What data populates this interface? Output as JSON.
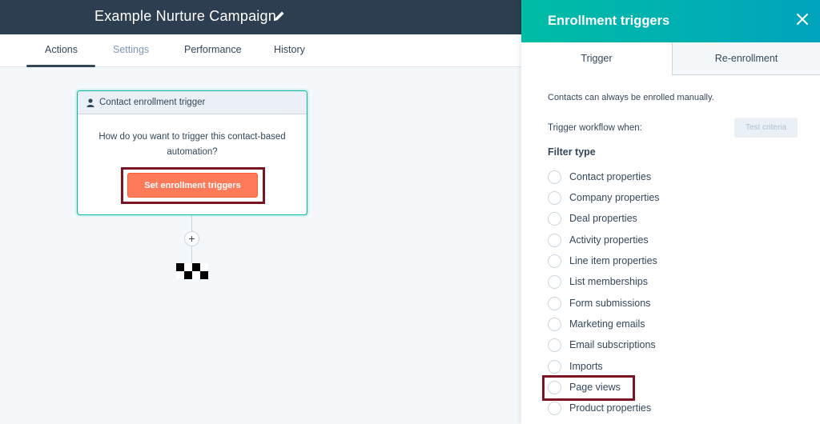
{
  "header": {
    "title": "Example Nurture Campaign",
    "edit_icon": "pencil-icon"
  },
  "tabs": [
    {
      "label": "Actions",
      "active": true
    },
    {
      "label": "Settings",
      "active": false
    },
    {
      "label": "Performance",
      "active": false
    },
    {
      "label": "History",
      "active": false
    }
  ],
  "card": {
    "header_icon": "person-icon",
    "header_label": "Contact enrollment trigger",
    "question_line1": "How do you want to trigger this contact-based",
    "question_line2": "automation?",
    "button_label": "Set enrollment triggers",
    "button_color": "#ff7a59"
  },
  "connector": {
    "plus_label": "+",
    "end_icon": "checkered-flag-icon"
  },
  "panel": {
    "title": "Enrollment triggers",
    "close_icon": "close-icon",
    "tabs": [
      {
        "label": "Trigger",
        "active": true
      },
      {
        "label": "Re-enrollment",
        "active": false
      }
    ],
    "note": "Contacts can always be enrolled manually.",
    "trigger_when": "Trigger workflow when:",
    "test_button": "Test criteria",
    "filter_type_label": "Filter type",
    "options": [
      "Contact properties",
      "Company properties",
      "Deal properties",
      "Activity properties",
      "Line item properties",
      "List memberships",
      "Form submissions",
      "Marketing emails",
      "Email subscriptions",
      "Imports",
      "Page views",
      "Product properties"
    ],
    "accent_colors": [
      "#00bda5",
      "#00a4bd"
    ]
  },
  "highlight_color": "#7d1424"
}
